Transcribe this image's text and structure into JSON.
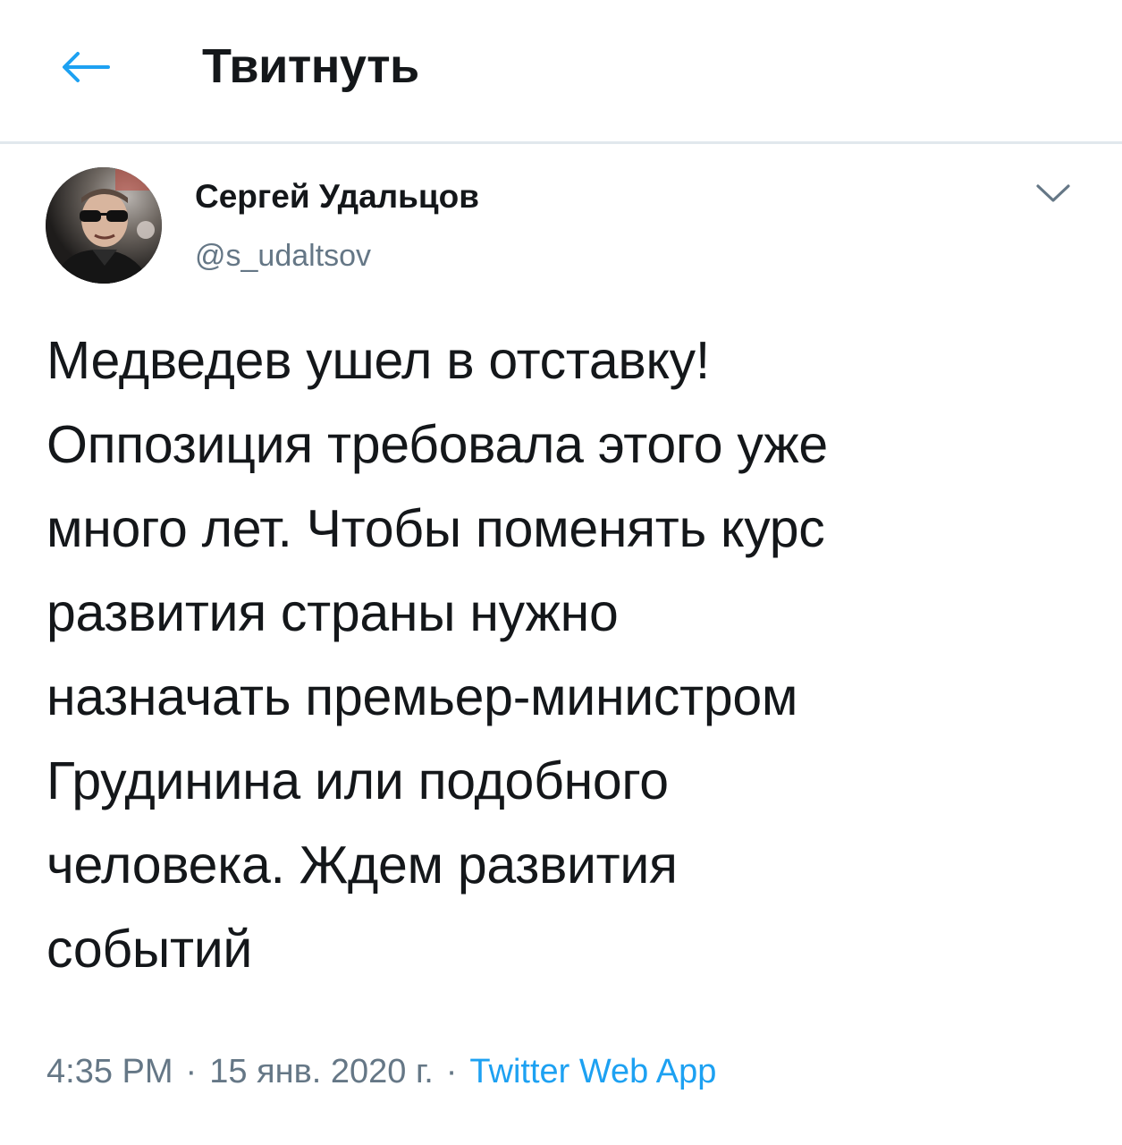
{
  "header": {
    "title": "Твитнуть",
    "back_icon": "arrow-left-icon"
  },
  "author": {
    "name": "Сергей Удальцов",
    "handle": "@s_udaltsov",
    "caret_icon": "chevron-down-icon"
  },
  "tweet": {
    "text": "Медведев ушел в отставку!\nОппозиция требовала этого уже\nмного лет. Чтобы поменять курс\nразвития страны нужно\nназначать премьер-министром\nГрудинина или подобного\nчеловека. Ждем развития\nсобытий"
  },
  "meta": {
    "time": "4:35 PM",
    "separator": "·",
    "date": "15 янв. 2020 г.",
    "source": "Twitter Web App"
  },
  "colors": {
    "accent": "#1da1f2",
    "text_primary": "#14171a",
    "text_secondary": "#657786",
    "divider": "#e1e8ed"
  }
}
